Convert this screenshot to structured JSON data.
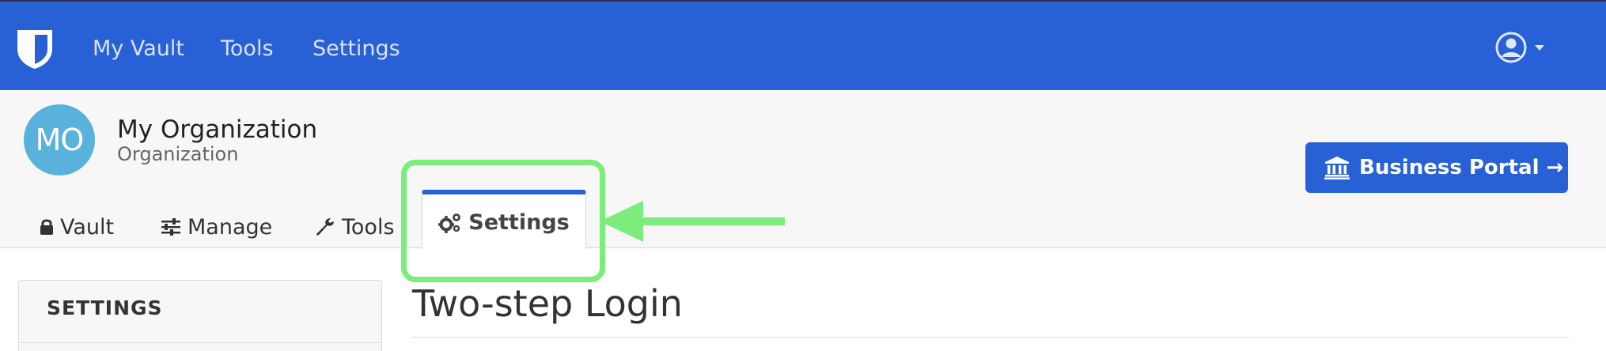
{
  "navbar": {
    "links": [
      "My Vault",
      "Tools",
      "Settings"
    ],
    "logo_icon": "bitwarden-shield-icon",
    "user_icon": "user-circle-icon",
    "background": "#2861d5"
  },
  "org": {
    "initials": "MO",
    "name": "My Organization",
    "type": "Organization",
    "avatar_color": "#58b2dc"
  },
  "business_portal": {
    "label": "Business Portal →",
    "icon": "bank-icon"
  },
  "tabs": [
    {
      "label": "Vault",
      "icon": "lock-icon"
    },
    {
      "label": "Manage",
      "icon": "sliders-icon"
    },
    {
      "label": "Tools",
      "icon": "wrench-icon"
    },
    {
      "label": "Settings",
      "icon": "cogs-icon",
      "active": true
    }
  ],
  "annotation": {
    "color": "#7cec7c",
    "target": "Settings"
  },
  "sidebar": {
    "title": "SETTINGS"
  },
  "main": {
    "title": "Two-step Login"
  }
}
